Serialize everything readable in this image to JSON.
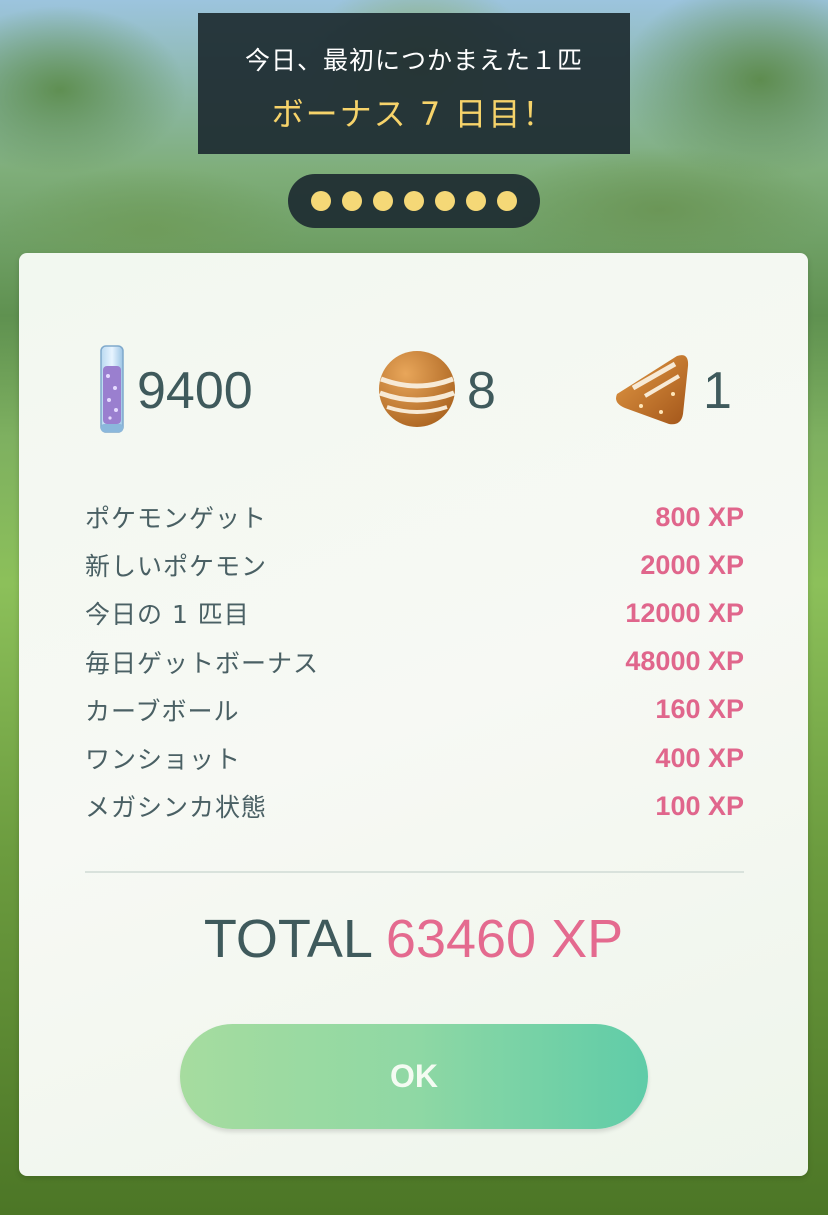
{
  "banner": {
    "line1": "今日、最初につかまえた１匹",
    "line2": "ボーナス 7 日目！"
  },
  "streak": {
    "days_completed": 7,
    "days_total": 7,
    "dot_color": "#f5d877"
  },
  "rewards": [
    {
      "icon": "stardust-icon",
      "count": "9400"
    },
    {
      "icon": "candy-icon",
      "count": "8"
    },
    {
      "icon": "xl-candy-icon",
      "count": "1"
    }
  ],
  "xp_items": [
    {
      "label": "ポケモンゲット",
      "value": "800 XP"
    },
    {
      "label": "新しいポケモン",
      "value": "2000 XP"
    },
    {
      "label": "今日の 1 匹目",
      "value": "12000 XP"
    },
    {
      "label": "毎日ゲットボーナス",
      "value": "48000 XP"
    },
    {
      "label": "カーブボール",
      "value": "160 XP"
    },
    {
      "label": "ワンショット",
      "value": "400 XP"
    },
    {
      "label": "メガシンカ状態",
      "value": "100 XP"
    }
  ],
  "total": {
    "label": "TOTAL",
    "value": "63460 XP"
  },
  "ok_button": {
    "label": "OK"
  },
  "colors": {
    "xp_pink": "#e0668c",
    "text_dark": "#3f5a5c",
    "banner_bg": "#1e2c32",
    "bonus_yellow": "#f6d36a"
  }
}
